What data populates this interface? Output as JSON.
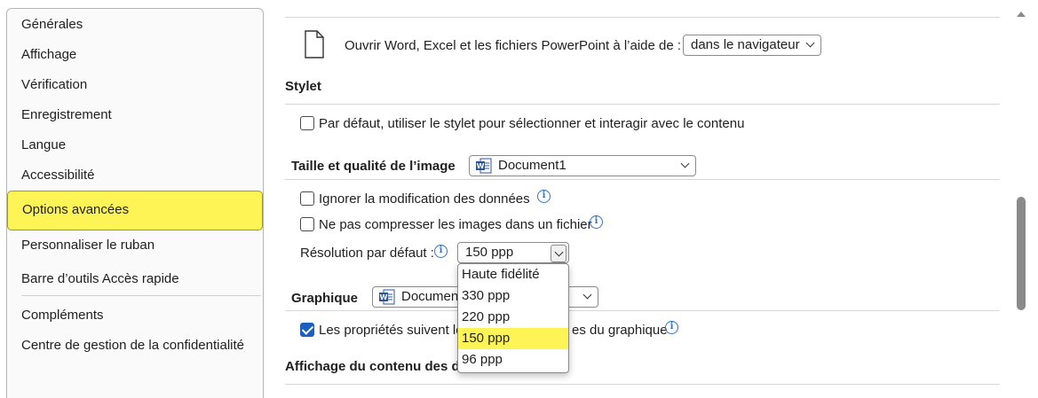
{
  "sidebar": {
    "items": [
      {
        "label": "Générales"
      },
      {
        "label": "Affichage"
      },
      {
        "label": "Vérification"
      },
      {
        "label": "Enregistrement"
      },
      {
        "label": "Langue"
      },
      {
        "label": "Accessibilité"
      },
      {
        "label": "Options avancées"
      },
      {
        "label": "Personnaliser le ruban"
      },
      {
        "label": "Barre d’outils Accès rapide"
      },
      {
        "label": "Compléments"
      },
      {
        "label": "Centre de gestion de la confidentialité"
      }
    ],
    "selected_color": "#fff455"
  },
  "main": {
    "open_files": {
      "label": "Ouvrir Word, Excel et les fichiers PowerPoint à l’aide de :",
      "value": "dans le navigateur"
    },
    "stylet": {
      "heading": "Stylet",
      "checkbox_label": "Par défaut, utiliser le stylet pour sélectionner et interagir avec le contenu",
      "checked": false
    },
    "image": {
      "heading": "Taille et qualité de l’image",
      "document": "Document1",
      "ignore_label": "Ignorer la modification des données",
      "ignore_checked": false,
      "no_compress_label": "Ne pas compresser les images dans un fichier",
      "no_compress_checked": false,
      "resolution_label": "Résolution par défaut :",
      "resolution_value": "150 ppp",
      "resolution_options": [
        "Haute fidélité",
        "330 ppp",
        "220 ppp",
        "150 ppp",
        "96 ppp"
      ],
      "highlighted_option": "150 ppp"
    },
    "graphique": {
      "heading": "Graphique",
      "document": "Document1",
      "checkbox_label_start": "Les propriétés suivent le",
      "checkbox_label_end": "es du graphique",
      "checked": true
    },
    "affichage": {
      "heading": "Affichage du contenu des do"
    }
  }
}
